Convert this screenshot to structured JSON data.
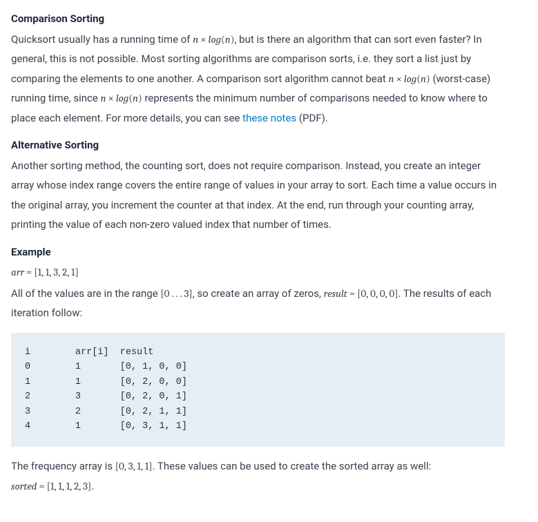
{
  "section1": {
    "heading": "Comparison Sorting",
    "p1a": "Quicksort usually has a running time of ",
    "expr1": "n × log(n)",
    "p1b": ", but is there an algorithm that can sort even faster? In general, this is not possible. Most sorting algorithms are comparison sorts, i.e. they sort a list just by comparing the elements to one another. A comparison sort algorithm cannot beat ",
    "expr2": "n × log(n)",
    "p1c": " (worst-case) running time, since ",
    "expr3": "n × log(n)",
    "p1d": " represents the minimum number of comparisons needed to know where to place each element. For more details, you can see ",
    "link_text": "these notes",
    "p1e": " (PDF)."
  },
  "section2": {
    "heading": "Alternative Sorting",
    "p1": "Another sorting method, the counting sort, does not require comparison. Instead, you create an integer array whose index range covers the entire range of values in your array to sort. Each time a value occurs in the original array, you increment the counter at that index. At the end, run through your counting array, printing the value of each non-zero valued index that number of times."
  },
  "section3": {
    "heading": "Example",
    "arr_expr": "arr = [1, 1, 3, 2, 1]",
    "p2a": "All of the values are in the range ",
    "range_expr": "[0 . . . 3]",
    "p2b": ", so create an array of zeros, ",
    "result_expr": "result = [0, 0, 0, 0]",
    "p2c": ". The results of each iteration follow:",
    "code": "i        arr[i]  result\n0        1       [0, 1, 0, 0]\n1        1       [0, 2, 0, 0]\n2        3       [0, 2, 0, 1]\n3        2       [0, 2, 1, 1]\n4        1       [0, 3, 1, 1]",
    "p3a": "The frequency array is ",
    "freq_expr": "[0, 3, 1, 1]",
    "p3b": ". These values can be used to create the sorted array as well: ",
    "sorted_expr": "sorted = [1, 1, 1, 2, 3]",
    "p3c": "."
  }
}
